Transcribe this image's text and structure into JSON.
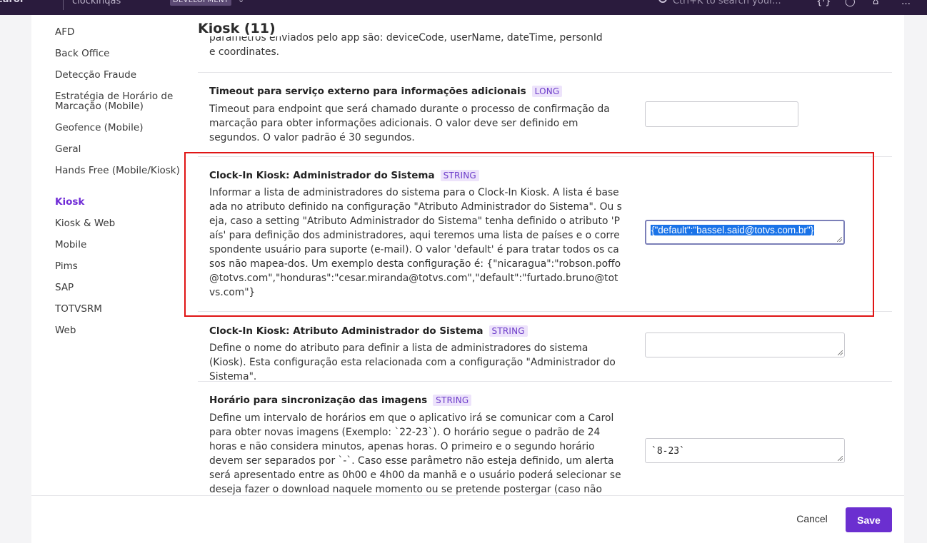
{
  "topbar": {
    "logo": "carol",
    "tenant": "clockinqas",
    "environment": "DEVELOPMENT",
    "search_placeholder": "Ctrl+K to search your..."
  },
  "sidebar": {
    "items": [
      {
        "label": "AFD",
        "active": false
      },
      {
        "label": "Back Office",
        "active": false
      },
      {
        "label": "Detecção Fraude",
        "active": false
      },
      {
        "label": "Estratégia de Horário de Marcação (Mobile)",
        "active": false
      },
      {
        "label": "Geofence (Mobile)",
        "active": false
      },
      {
        "label": "Geral",
        "active": false
      },
      {
        "label": "Hands Free (Mobile/Kiosk)",
        "active": false
      },
      {
        "label": "Kiosk",
        "active": true
      },
      {
        "label": "Kiosk & Web",
        "active": false
      },
      {
        "label": "Mobile",
        "active": false
      },
      {
        "label": "Pims",
        "active": false
      },
      {
        "label": "SAP",
        "active": false
      },
      {
        "label": "TOTVSRM",
        "active": false
      },
      {
        "label": "Web",
        "active": false
      }
    ]
  },
  "main": {
    "title": "Kiosk (11)",
    "partial_desc": "parâmetros enviados pelo app são: deviceCode, userName, dateTime, personId e coordinates.",
    "settings": [
      {
        "name": "Timeout para serviço externo para informações adicionais",
        "type": "LONG",
        "description": "Timeout para endpoint que será chamado durante o processo de confirmação da marcação para obter informações adicionais. O valor deve ser definido em segundos. O valor padrão é 30 segundos.",
        "value": ""
      },
      {
        "name": "Clock-In Kiosk: Administrador do Sistema",
        "type": "STRING",
        "description": "Informar a lista de administradores do sistema para o Clock-In Kiosk. A lista é baseada no atributo definido na configuração \"Atributo Administrador do Sistema\". Ou seja, caso a setting \"Atributo Administrador do Sistema\" tenha definido o atributo 'País' para definição dos administradores, aqui teremos uma lista de países e o correspondente usuário para suporte (e-mail). O valor 'default' é para tratar todos os casos não mapea-dos. Um exemplo desta configuração é: {\"nicaragua\":\"robson.poffo@totvs.com\",\"honduras\":\"cesar.miranda@totvs.com\",\"default\":\"furtado.bruno@totvs.com\"}",
        "value": "{\"default\":\"bassel.said@totvs.com.br\"}"
      },
      {
        "name": "Clock-In Kiosk: Atributo Administrador do Sistema",
        "type": "STRING",
        "description": "Define o nome do atributo para definir a lista de administradores do sistema (Kiosk). Esta configuração esta relacionada com a configuração \"Administrador do Sistema\".",
        "value": ""
      },
      {
        "name": "Horário para sincronização das imagens",
        "type": "STRING",
        "description": "Define um intervalo de horários em que o aplicativo irá se comunicar com a Carol para obter novas imagens (Exemplo: `22-23`). O horário segue o padrão de 24 horas e não considera minutos, apenas horas. O primeiro e o segundo horário devem ser separados por `-`. Caso esse parâmetro não esteja definido, um alerta será apresentado entre as 0h00 e 4h00 da manhã e o usuário poderá selecionar se deseja fazer o download naquele momento ou se pretende postergar (caso não haja nenhuma seleção, o aplica-",
        "value": "`8-23`"
      }
    ]
  },
  "footer": {
    "cancel_label": "Cancel",
    "save_label": "Save"
  },
  "colors": {
    "accent": "#6b2fd0",
    "topbar": "#2a1b3d",
    "highlight": "#e01515",
    "badge_bg": "#ede3fb"
  }
}
